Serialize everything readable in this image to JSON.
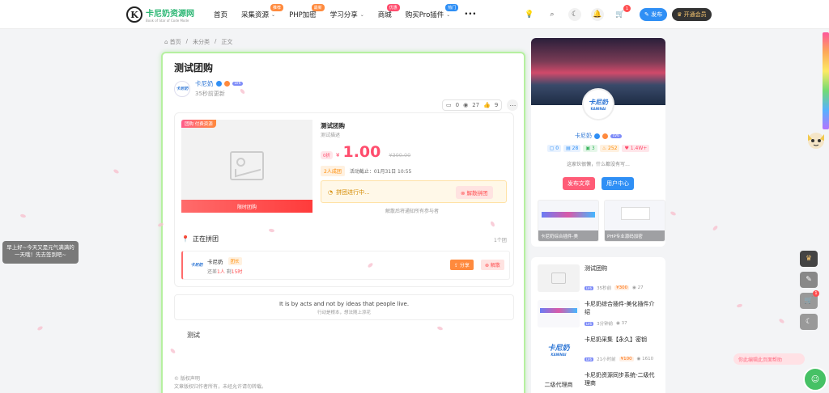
{
  "header": {
    "logo_title": "卡尼奶资源网",
    "logo_sub": "Book of Star of Code Mode",
    "nav": [
      {
        "label": "首页",
        "badge": "",
        "badge_color": "",
        "dropdown": false
      },
      {
        "label": "采集资源",
        "badge": "推荐",
        "badge_color": "#ff8a3d",
        "dropdown": true
      },
      {
        "label": "PHP加密",
        "badge": "最新",
        "badge_color": "#ff8a3d",
        "dropdown": false
      },
      {
        "label": "学习分享",
        "badge": "",
        "badge_color": "",
        "dropdown": true
      },
      {
        "label": "商城",
        "badge": "优惠",
        "badge_color": "#ff4d6d",
        "dropdown": false
      },
      {
        "label": "购买Pro插件",
        "badge": "热门",
        "badge_color": "#2f8ff5",
        "dropdown": true
      }
    ],
    "more": "•••",
    "cart_count": "1",
    "publish_label": "✎ 发布",
    "vip_label": "♛ 开通会员"
  },
  "breadcrumb": {
    "home": "⌂ 首页",
    "category": "未分类",
    "current": "正文",
    "sep": "/"
  },
  "post": {
    "title": "测试团购",
    "author_name": "卡尼奶",
    "author_level": "LV6",
    "author_time": "35秒前更新",
    "comments": "0",
    "views": "27",
    "likes": "9",
    "avatar_text": "卡尼奶"
  },
  "group": {
    "tag": "团购 付费资源",
    "limited_label": "限时团购",
    "title": "测试团购",
    "desc": "测试描述",
    "price_tag": "0折",
    "currency": "¥",
    "price": "1.00",
    "old_price": "¥300.00",
    "group_num": "2人成团",
    "deadline": "活动截止：01月31日 10:55",
    "status": "拼团进行中...",
    "dissolve_btn": "⊗ 解散拼团",
    "notify_tip": "解散后将通知所有参与者",
    "ing_title": "正在拼团",
    "ing_count": "1个团",
    "member_name": "卡尼奶",
    "member_role": "团长",
    "member_need_prefix": "还差",
    "member_need_num": "1人",
    "member_left_prefix": "剩",
    "member_left_num": "15时",
    "share_btn": "⇪ 分享",
    "member_dissolve": "⊗ 解散"
  },
  "quote": {
    "en": "It is by acts and not by ideas that people live.",
    "cn": "行动是根本，想法随上添花"
  },
  "content": {
    "text": "测试"
  },
  "copyright": {
    "line1": "© 版权声明",
    "line2": "文章版权归作者所有，未经允许请勿转载。"
  },
  "sidebar": {
    "author_name": "卡尼奶",
    "author_level": "LV6",
    "avatar_text": "卡尼奶",
    "avatar_sub": "KANINAI",
    "stats": [
      {
        "label": "▢ 0",
        "color": "#2f8ff5",
        "bg": "#e8f2ff"
      },
      {
        "label": "▤ 28",
        "color": "#2f8ff5",
        "bg": "#e8f2ff"
      },
      {
        "label": "▣ 3",
        "color": "#35b35a",
        "bg": "#e6f7ea"
      },
      {
        "label": "♨ 252",
        "color": "#ff8a00",
        "bg": "#fff1e0"
      },
      {
        "label": "♥ 1.4W+",
        "color": "#ff4d6d",
        "bg": "#ffe6ea"
      }
    ],
    "bio": "这家伙很懒，什么都没有写...",
    "btn_publish": "发布文章",
    "btn_center": "用户中心",
    "thumb1": "卡尼奶综合插件-美",
    "thumb2": "PHP专业源码加密"
  },
  "list": [
    {
      "title": "测试团购",
      "time": "35秒前",
      "price": "¥300",
      "views": "◉ 27",
      "img": "placeholder"
    },
    {
      "title": "卡尼奶综合插件-美化插件介绍",
      "time": "3分钟前",
      "price": "",
      "views": "◉ 37",
      "img": "ui"
    },
    {
      "title": "卡尼奶采集【永久】密钥",
      "time": "21小时前",
      "price": "¥100",
      "views": "◉ 1610",
      "img": "logo"
    },
    {
      "title": "卡尼奶资源同步系统-二级代理商",
      "time": "",
      "price": "",
      "views": "",
      "img": "logo2"
    }
  ],
  "list_lv": "LV6",
  "list_img_text": "卡尼奶",
  "list_img_sub": "KANINAI",
  "list_img_text2": "二级代理商",
  "greet": "早上好~今天又是元气满满的一天哦！先去签到吧~",
  "corner_tip": "你此编辑此页面帮助",
  "colors": {
    "accent": "#2f8ff5",
    "price": "#ff4d6d",
    "green_border": "#b6f0a0"
  }
}
